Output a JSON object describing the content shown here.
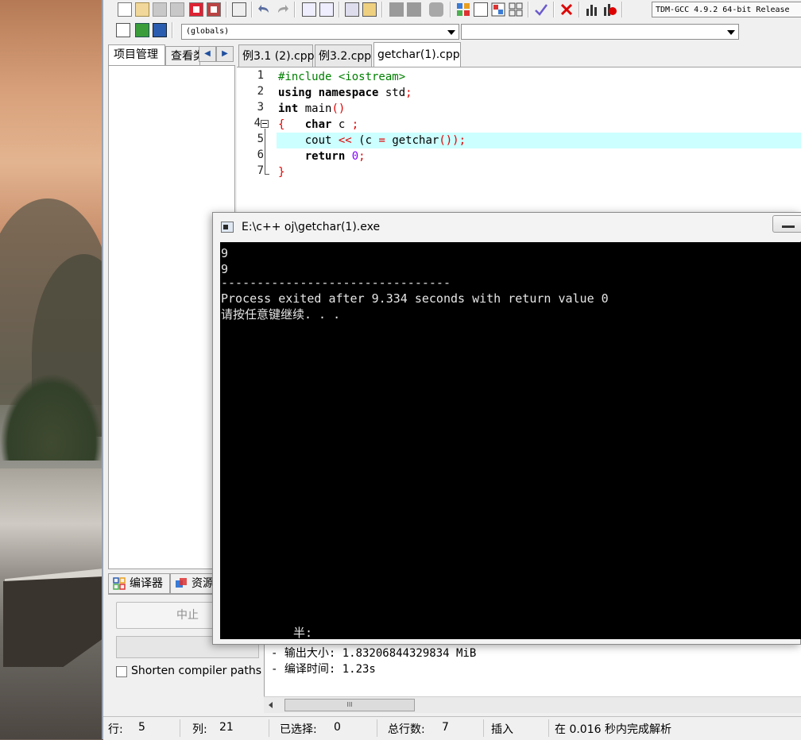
{
  "toolbar": {
    "compiler_select": "TDM-GCC 4.9.2 64-bit Release",
    "globals_select": "(globals)",
    "members_select": ""
  },
  "left_panel": {
    "tabs": [
      "项目管理",
      "查看类"
    ]
  },
  "editor": {
    "tabs": [
      "例3.1 (2).cpp",
      "例3.2.cpp",
      "getchar(1).cpp"
    ],
    "active_tab": "getchar(1).cpp",
    "line_numbers": [
      "1",
      "2",
      "3",
      "4",
      "5",
      "6",
      "7"
    ],
    "code": {
      "l1_directive": "#include <iostream>",
      "l2_kw": "using namespace",
      "l2_rest": " std",
      "l2_semi": ";",
      "l3_kw": "int",
      "l3_rest": " main",
      "l3_paren": "()",
      "l4_brace": "{",
      "l4_kw": "char",
      "l4_rest": " c ",
      "l4_semi": ";",
      "l5_a": "cout ",
      "l5_op": "<<",
      "l5_b": " (c ",
      "l5_eq": "=",
      "l5_c": " getchar",
      "l5_d": "());",
      "l6_kw": "return",
      "l6_num": "0",
      "l6_semi": ";",
      "l7_brace": "}"
    }
  },
  "console": {
    "title": "E:\\c++ oj\\getchar(1).exe",
    "lines": [
      "9",
      "9",
      "--------------------------------",
      "Process exited after 9.334 seconds with return value 0",
      "请按任意键继续. . ."
    ],
    "ghost_text": "半:"
  },
  "bottom_panel": {
    "tabs": [
      "编译器",
      "资源"
    ],
    "stop_button": "中止",
    "shorten_paths_label": "Shorten compiler paths",
    "log_lines": [
      "- 输出大小: 1.83206844329834 MiB",
      "- 编译时间: 1.23s"
    ],
    "scroll_thumb": "III"
  },
  "statusbar": {
    "line_label": "行:",
    "line_value": "5",
    "col_label": "列:",
    "col_value": "21",
    "selected_label": "已选择:",
    "selected_value": "0",
    "total_label": "总行数:",
    "total_value": "7",
    "mode": "插入",
    "parse_time": "在 0.016 秒内完成解析"
  }
}
